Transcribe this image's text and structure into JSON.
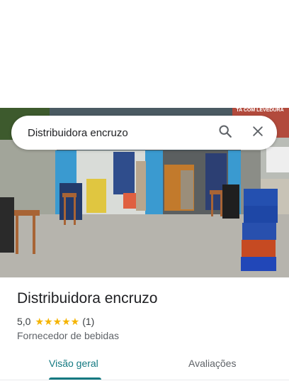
{
  "search": {
    "query": "Distribuidora encruzo",
    "search_icon": "search-icon",
    "close_icon": "close-icon"
  },
  "photo": {
    "sign_text": "TA COM LEVEDURA"
  },
  "place": {
    "name": "Distribuidora encruzo",
    "rating": "5,0",
    "stars": "★★★★★",
    "review_count": "(1)",
    "category": "Fornecedor de bebidas"
  },
  "tabs": [
    {
      "label": "Visão geral",
      "active": true
    },
    {
      "label": "Avaliações",
      "active": false
    }
  ],
  "colors": {
    "accent": "#137981",
    "star": "#f5b400"
  }
}
